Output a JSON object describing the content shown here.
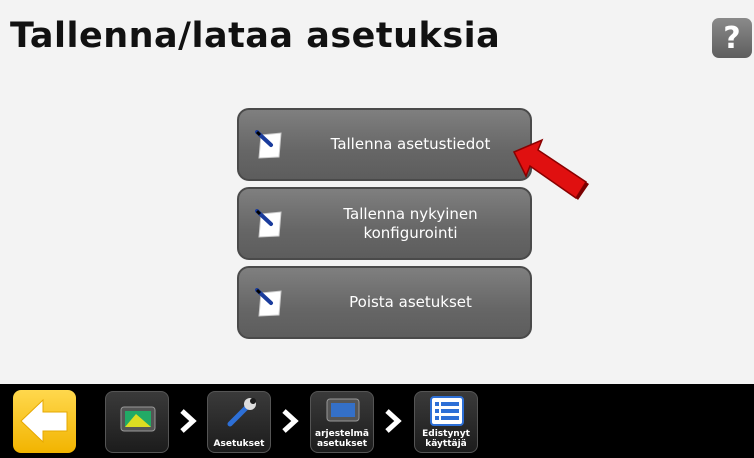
{
  "header": {
    "title": "Tallenna/lataa asetuksia",
    "help_label": "?"
  },
  "menu": {
    "items": [
      {
        "label": "Tallenna asetustiedot",
        "icon": "document-pen-icon"
      },
      {
        "label": "Tallenna nykyinen\nkonfigurointi",
        "icon": "document-pen-icon"
      },
      {
        "label": "Poista asetukset",
        "icon": "document-pen-icon"
      }
    ]
  },
  "annotation": {
    "icon": "red-pointer-arrow",
    "color": "#e01010"
  },
  "bottom_bar": {
    "back_icon": "back-arrow-icon",
    "back_color": "#f2b400",
    "breadcrumbs": [
      {
        "label": "",
        "icon": "display-icon"
      },
      {
        "label": "Asetukset",
        "icon": "wrench-icon"
      },
      {
        "label": "arjestelmä\nasetukset",
        "icon": "monitor-icon"
      },
      {
        "label": "Edistynyt\nkäyttäjä",
        "icon": "list-icon"
      }
    ]
  }
}
